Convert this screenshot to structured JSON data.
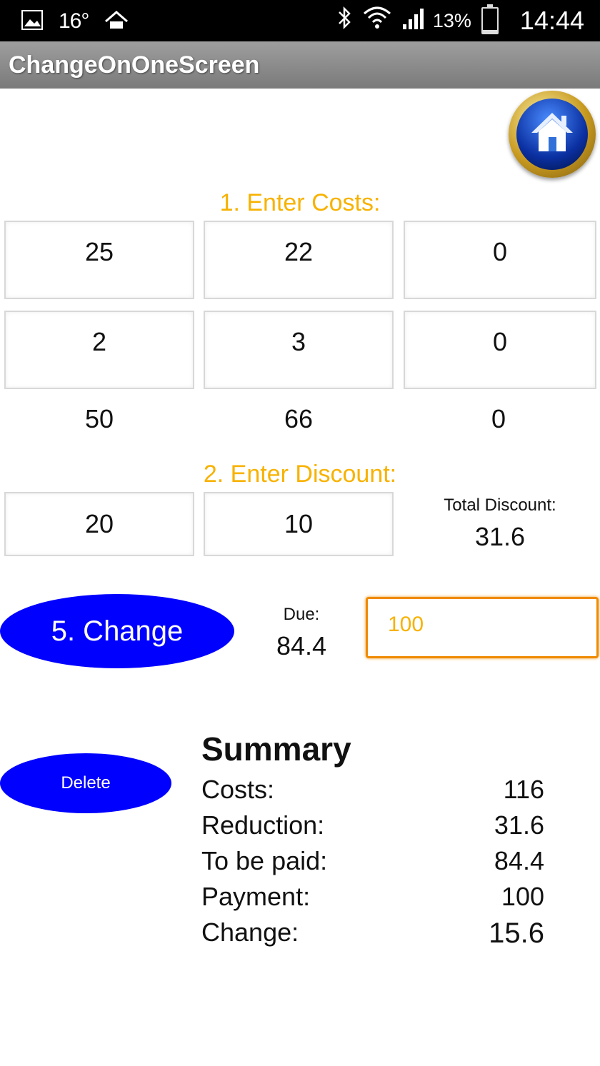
{
  "status_bar": {
    "temperature": "16°",
    "battery_percent": "13%",
    "battery_level": 0.13,
    "time": "14:44",
    "icons": [
      "gallery-icon",
      "home-notification-icon",
      "bluetooth-icon",
      "wifi-icon",
      "signal-icon",
      "battery-icon"
    ]
  },
  "app": {
    "title": "ChangeOnOneScreen"
  },
  "home_button": {
    "icon": "home-icon"
  },
  "costs": {
    "label": "1. Enter Costs:",
    "prices": [
      "25",
      "22",
      "0"
    ],
    "quantities": [
      "2",
      "3",
      "0"
    ],
    "subtotals": [
      "50",
      "66",
      "0"
    ]
  },
  "discount": {
    "label": "2. Enter Discount:",
    "values": [
      "20",
      "10"
    ],
    "total_label": "Total Discount:",
    "total_value": "31.6"
  },
  "change_button": {
    "label": "5. Change"
  },
  "due": {
    "label": "Due:",
    "value": "84.4"
  },
  "payment_input": {
    "value": "100"
  },
  "delete_button": {
    "label": "Delete"
  },
  "summary": {
    "title": "Summary",
    "rows": [
      {
        "label": "Costs:",
        "value": "116"
      },
      {
        "label": "Reduction:",
        "value": "31.6"
      },
      {
        "label": "To be paid:",
        "value": "84.4"
      },
      {
        "label": "Payment:",
        "value": "100"
      },
      {
        "label": "Change:",
        "value": "15.6"
      }
    ]
  },
  "colors": {
    "accent_label": "#f7b200",
    "button_blue": "#0000ff",
    "input_focus_border": "#f08a00",
    "titlebar": "#8a8a8a"
  }
}
